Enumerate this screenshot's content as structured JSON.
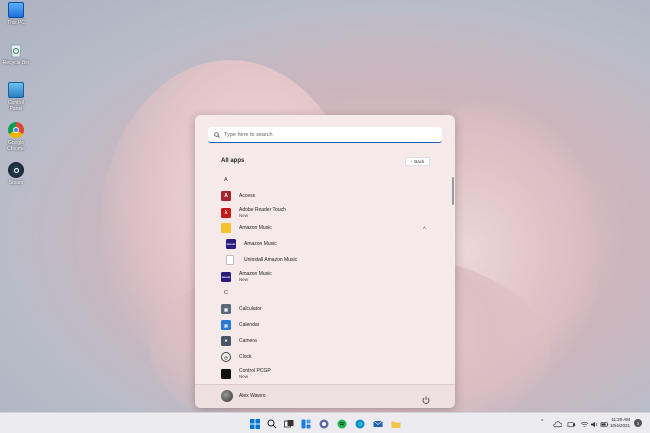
{
  "desktop": {
    "icons": [
      {
        "label": "This PC",
        "icon": "monitor-icon"
      },
      {
        "label": "Recycle Bin",
        "icon": "recycle-bin-icon"
      },
      {
        "label": "Control Panel",
        "icon": "control-panel-icon"
      },
      {
        "label": "Google Chrome",
        "icon": "chrome-icon"
      },
      {
        "label": "Steam",
        "icon": "steam-icon"
      }
    ]
  },
  "start_menu": {
    "search": {
      "placeholder": "Type here to search"
    },
    "header": "All apps",
    "back_label": "Back",
    "letters": [
      "A",
      "C"
    ],
    "apps": [
      {
        "name": "Access",
        "sub": "",
        "color": "#a4262c"
      },
      {
        "name": "Adobe Reader Touch",
        "sub": "New",
        "color": "#c21a1a"
      },
      {
        "name": "Amazon Music",
        "sub": "",
        "color": "#f4c430"
      },
      {
        "name": "Amazon Music",
        "sub": "",
        "color": "#2a1b7d"
      },
      {
        "name": "Uninstall Amazon Music",
        "sub": "",
        "color": "#ffffff"
      },
      {
        "name": "Amazon Music",
        "sub": "New",
        "color": "#2a1b7d"
      },
      {
        "name": "Calculator",
        "sub": "",
        "color": "#5a6a7a"
      },
      {
        "name": "Calendar",
        "sub": "",
        "color": "#2b79d6"
      },
      {
        "name": "Camera",
        "sub": "",
        "color": "#4a5568"
      },
      {
        "name": "Clock",
        "sub": "",
        "color": "#eeeeee"
      },
      {
        "name": "Control PCGP",
        "sub": "New",
        "color": "#111111"
      }
    ],
    "user": {
      "name": "Alex Wawro"
    }
  },
  "taskbar": {
    "clock_time": "11:20 AM",
    "clock_date": "10/4/2021",
    "notification_count": "3",
    "tray_chevron": "^"
  }
}
